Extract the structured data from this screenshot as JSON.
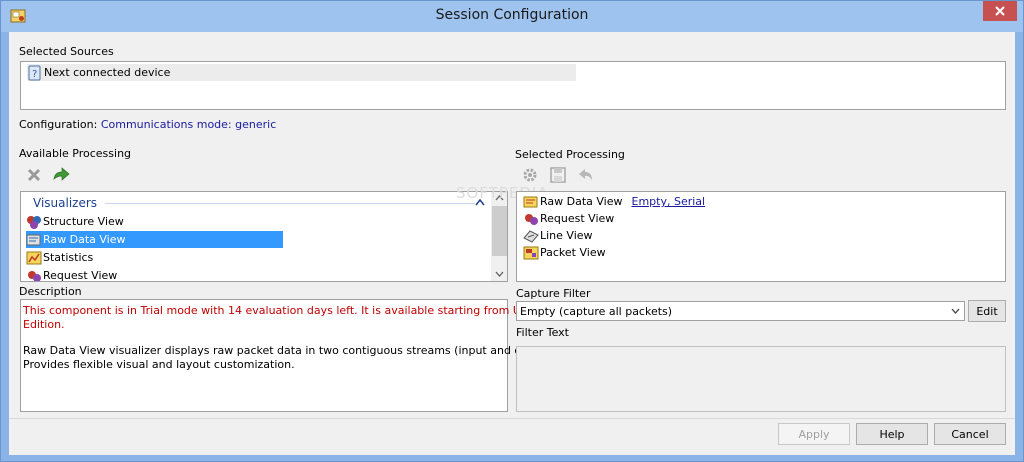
{
  "window": {
    "title": "Session Configuration"
  },
  "sources": {
    "label": "Selected Sources",
    "items": [
      {
        "label": "Next connected device",
        "icon": "device-icon"
      }
    ]
  },
  "config": {
    "label": "Configuration:",
    "value": "Communications mode: generic"
  },
  "available": {
    "label": "Available Processing",
    "group": "Visualizers",
    "items": [
      {
        "label": "Structure View",
        "icon": "structure-view-icon"
      },
      {
        "label": "Raw Data View",
        "icon": "raw-data-view-icon",
        "selected": true
      },
      {
        "label": "Statistics",
        "icon": "statistics-icon"
      },
      {
        "label": "Request View",
        "icon": "request-view-icon"
      }
    ]
  },
  "selected_processing": {
    "label": "Selected Processing",
    "items": [
      {
        "label": "Raw Data View",
        "extra": "Empty, Serial"
      },
      {
        "label": "Request View"
      },
      {
        "label": "Line View"
      },
      {
        "label": "Packet View"
      }
    ]
  },
  "description": {
    "label": "Description",
    "trial_line1": "This component is in Trial mode with 14 evaluation days left. It is available starting from Ultimate",
    "trial_line2": "Edition.",
    "text_line1": "Raw Data View visualizer displays raw packet data in two contiguous streams (input and output).",
    "text_line2": "Provides flexible visual and layout customization."
  },
  "capture_filter": {
    "label": "Capture Filter",
    "selected": "Empty (capture all packets)",
    "edit_label": "Edit"
  },
  "filter_text": {
    "label": "Filter Text"
  },
  "buttons": {
    "apply": "Apply",
    "help": "Help",
    "cancel": "Cancel"
  },
  "watermark": "SOFTPEDIA",
  "colors": {
    "title_bar": "#9ec3ef",
    "selection": "#3399ff",
    "link": "#1a1a9f",
    "trial_text": "#c00000"
  }
}
